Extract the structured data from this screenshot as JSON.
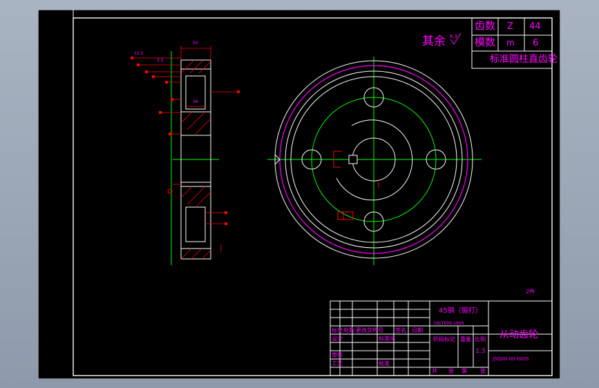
{
  "colors": {
    "outline": "#ffffff",
    "center_line": "#00ff00",
    "gear_ring": "#ff00ff",
    "dimension": "#ff0000",
    "title_text": "#ff00ff",
    "background": "#000000",
    "viewport": "#a9b4c2"
  },
  "surface_note": {
    "text": "其余",
    "roughness": "6.3"
  },
  "gear_params": {
    "rows": [
      {
        "label": "齿数",
        "symbol": "Z",
        "value": "44"
      },
      {
        "label": "模数",
        "symbol": "m",
        "value": "6"
      }
    ],
    "standard": "标准圆柱直齿轮"
  },
  "section_view": {
    "width_dim": "50",
    "hub_dim": "36",
    "roughness": [
      "12.5",
      "3.2"
    ]
  },
  "page_mark": "2件",
  "title_block": {
    "material": "45钢（锻打）",
    "standard_ref": "GB/T699-1999",
    "revision_headers": [
      "标记",
      "处数",
      "更改文件号",
      "签名",
      "日期"
    ],
    "rows_left": [
      "设计",
      "审核",
      "工艺"
    ],
    "standardize": "标准化",
    "approve": "批准",
    "stage_headers": [
      "阶段标记",
      "重量",
      "比例"
    ],
    "scale": "1.3",
    "sheet_labels": [
      "共",
      "张",
      "第",
      "张"
    ],
    "part_name": "从动齿轮",
    "drawing_no": "JSQ00-00-0005"
  }
}
